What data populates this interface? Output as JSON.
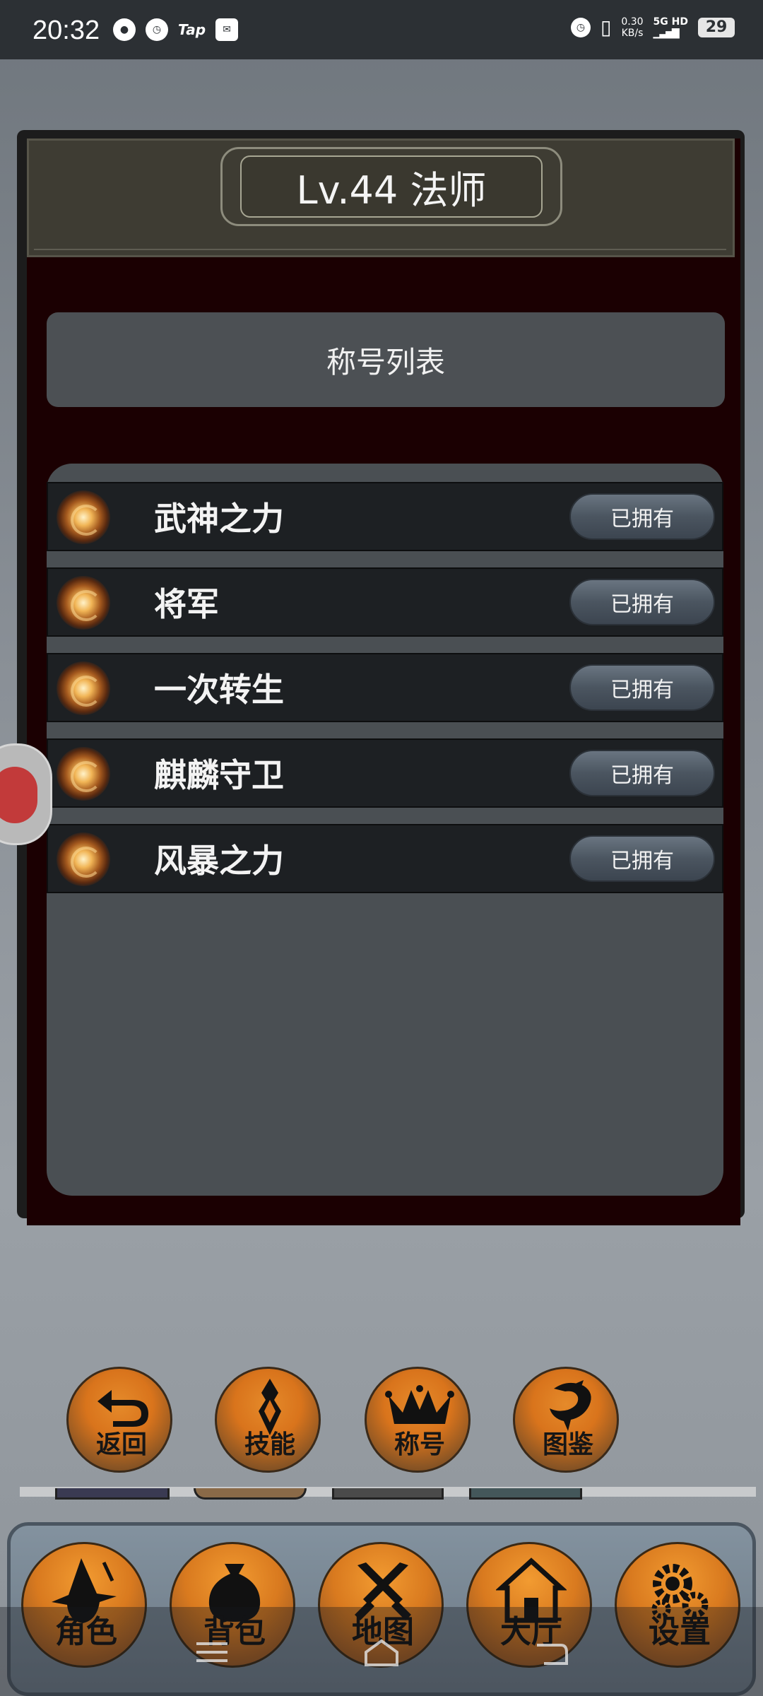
{
  "status_bar": {
    "time": "20:32",
    "tap_label": "Tap",
    "speed_value": "0.30",
    "speed_unit": "KB/s",
    "network": "5G HD",
    "battery": "29"
  },
  "panel": {
    "title": "Lv.44 法师",
    "list_header": "称号列表"
  },
  "titles": [
    {
      "name": "武神之力",
      "status": "已拥有"
    },
    {
      "name": "将军",
      "status": "已拥有"
    },
    {
      "name": "一次转生",
      "status": "已拥有"
    },
    {
      "name": "麒麟守卫",
      "status": "已拥有"
    },
    {
      "name": "风暴之力",
      "status": "已拥有"
    }
  ],
  "sub_actions": [
    {
      "label": "返回",
      "icon": "return-arrow-icon"
    },
    {
      "label": "技能",
      "icon": "skill-emblem-icon"
    },
    {
      "label": "称号",
      "icon": "crown-icon"
    },
    {
      "label": "图鉴",
      "icon": "dragon-icon"
    }
  ],
  "bottom_nav": [
    {
      "label": "角色",
      "icon": "wizard-icon"
    },
    {
      "label": "背包",
      "icon": "bag-icon"
    },
    {
      "label": "地图",
      "icon": "crossed-swords-icon"
    },
    {
      "label": "大厅",
      "icon": "house-icon"
    },
    {
      "label": "设置",
      "icon": "gear-icon"
    }
  ],
  "colors": {
    "accent_orange": "#d97a1f",
    "panel_bg": "#1b0002",
    "list_bg": "#4a4f53"
  }
}
